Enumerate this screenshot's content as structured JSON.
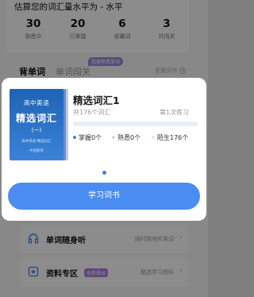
{
  "stats": {
    "estimate": "估算您的词汇量水平为 - 水平",
    "items": [
      {
        "value": "30",
        "label": "熟悉中"
      },
      {
        "value": "20",
        "label": "已掌握"
      },
      {
        "value": "6",
        "label": "收藏词"
      },
      {
        "value": "3",
        "label": "共闯关"
      }
    ]
  },
  "tabs": {
    "active": "背单词",
    "inactive": "单词闯关",
    "badge": "加速熟悉单词",
    "change_book": "更换词书",
    "change_book_icon": "plus-circle-icon"
  },
  "book": {
    "cover": {
      "top": "高中英语",
      "title": "精选词汇",
      "volume": "(一)",
      "subtitle": "高中英语 精选词汇",
      "publisher": "中国教育"
    },
    "title": "精选词汇1",
    "word_count": "共176个词汇",
    "practice": "第1次练习",
    "progress": 0.0,
    "legend": [
      {
        "label": "掌握0个",
        "color": "#3d82ef"
      },
      {
        "label": "熟悉0个",
        "color": "#c9d9f6"
      },
      {
        "label": "陌生176个",
        "color": "#e7e9ee"
      }
    ]
  },
  "study_button": "学习词书",
  "cards": [
    {
      "title": "单词随身听",
      "hint": "随时随地听单词",
      "icon": "headphones-icon"
    },
    {
      "title": "资料专区",
      "badge": "全新推出",
      "hint": "精选学习资料",
      "icon": "star-book-icon"
    }
  ],
  "colors": {
    "accent": "#4a8cf0",
    "progress": "#3d82ef",
    "badge_tab": "#9b8dd9",
    "badge_card": "#b07de6"
  }
}
